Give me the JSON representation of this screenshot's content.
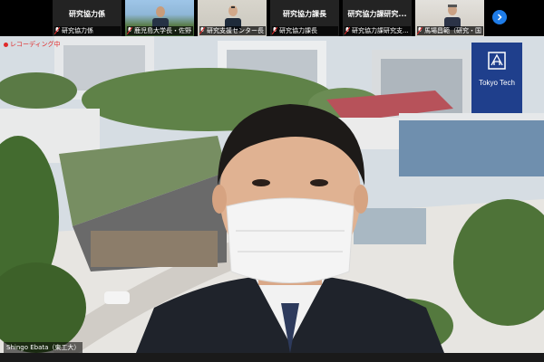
{
  "participants": [
    {
      "type": "name",
      "center": "研究協力係",
      "tag": "研究協力係"
    },
    {
      "type": "video",
      "scene": "a",
      "tag": "鹿児島大学長・佐野"
    },
    {
      "type": "video",
      "scene": "b",
      "tag": "研究支援センター長"
    },
    {
      "type": "name",
      "center": "研究協力課長",
      "tag": "研究協力課長"
    },
    {
      "type": "name",
      "center": "研究協力課研究...",
      "tag": "研究協力課研究支..."
    },
    {
      "type": "video",
      "scene": "c",
      "tag": "馬場昌範（研究・国"
    }
  ],
  "next_button_icon": "chevron-right-icon",
  "recording": {
    "label": "レコーディング中"
  },
  "logo": {
    "text": "Tokyo Tech",
    "color": "#1f3f8c"
  },
  "speaker": {
    "name": "Shingo Ebata（東工大）"
  },
  "colors": {
    "zoom_blue": "#1e7ce8",
    "rec_red": "#e02a2a"
  }
}
